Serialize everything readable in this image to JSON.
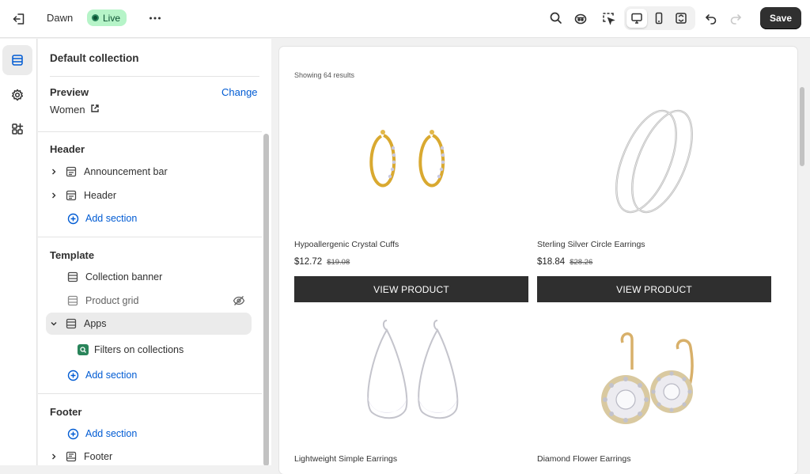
{
  "topbar": {
    "theme_name": "Dawn",
    "live_label": "Live",
    "save_label": "Save"
  },
  "sidebar": {
    "title": "Default collection",
    "preview_label": "Preview",
    "change_label": "Change",
    "preview_value": "Women",
    "groups": {
      "header": {
        "title": "Header",
        "items": [
          {
            "label": "Announcement bar",
            "icon": "section-icon"
          },
          {
            "label": "Header",
            "icon": "section-icon"
          }
        ],
        "add_label": "Add section"
      },
      "template": {
        "title": "Template",
        "items": [
          {
            "label": "Collection banner",
            "icon": "section-icon"
          },
          {
            "label": "Product grid",
            "icon": "section-icon",
            "hidden": true
          },
          {
            "label": "Apps",
            "icon": "section-icon",
            "expanded": true
          },
          {
            "label": "Filters on collections",
            "icon": "app-block-icon"
          }
        ],
        "add_label": "Add section"
      },
      "footer": {
        "title": "Footer",
        "add_label": "Add section",
        "items": [
          {
            "label": "Footer",
            "icon": "section-icon"
          }
        ]
      }
    }
  },
  "canvas": {
    "results_text": "Showing 64 results",
    "products": [
      {
        "title": "Hypoallergenic Crystal Cuffs",
        "price": "$12.72",
        "compare_price": "$19.08",
        "button": "VIEW PRODUCT"
      },
      {
        "title": "Sterling Silver Circle Earrings",
        "price": "$18.84",
        "compare_price": "$28.26",
        "button": "VIEW PRODUCT"
      },
      {
        "title": "Lightweight Simple Earrings"
      },
      {
        "title": "Diamond Flower Earrings"
      }
    ]
  },
  "colors": {
    "accent_link": "#005bd3",
    "live_badge_bg": "#b6f4c8",
    "primary_button": "#303030",
    "product_button": "#2f2f2f"
  }
}
